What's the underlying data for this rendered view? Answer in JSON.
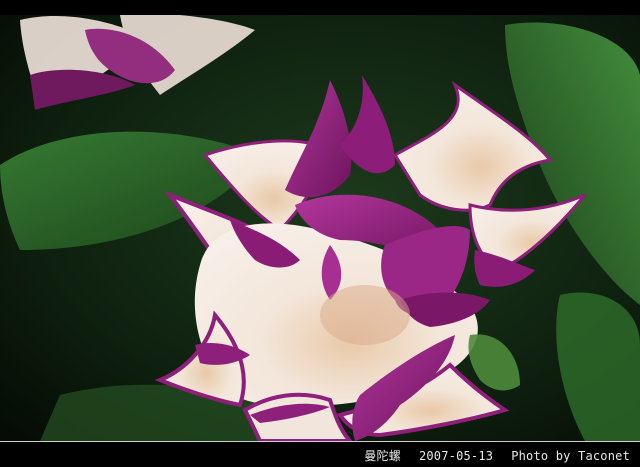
{
  "photo": {
    "subject_icon": "flower-photo",
    "colors": {
      "petal_purple": "#8e1f7a",
      "petal_cream": "#efe2d6",
      "leaf_green": "#2f6b2c",
      "background_dark": "#0d1a0e"
    }
  },
  "caption": {
    "title": "曼陀螺",
    "date": "2007-05-13",
    "credit": "Photo by Taconet"
  }
}
